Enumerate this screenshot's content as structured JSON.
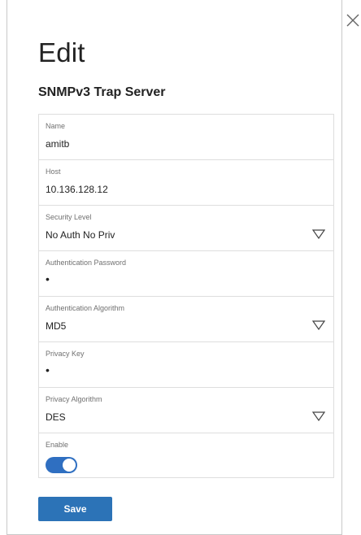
{
  "dialog": {
    "title": "Edit",
    "subtitle": "SNMPv3 Trap Server",
    "close_icon": "close-icon"
  },
  "fields": {
    "name": {
      "label": "Name",
      "value": "amitb"
    },
    "host": {
      "label": "Host",
      "value": "10.136.128.12"
    },
    "security_level": {
      "label": "Security Level",
      "value": "No Auth No Priv"
    },
    "auth_password": {
      "label": "Authentication Password",
      "value": "•"
    },
    "auth_algorithm": {
      "label": "Authentication Algorithm",
      "value": "MD5"
    },
    "privacy_key": {
      "label": "Privacy Key",
      "value": "•"
    },
    "privacy_algorithm": {
      "label": "Privacy Algorithm",
      "value": "DES"
    },
    "enable": {
      "label": "Enable",
      "on": true
    }
  },
  "actions": {
    "save_label": "Save"
  },
  "colors": {
    "accent": "#2c73b7",
    "toggle_on": "#2f6fc1",
    "border": "#dedede"
  }
}
